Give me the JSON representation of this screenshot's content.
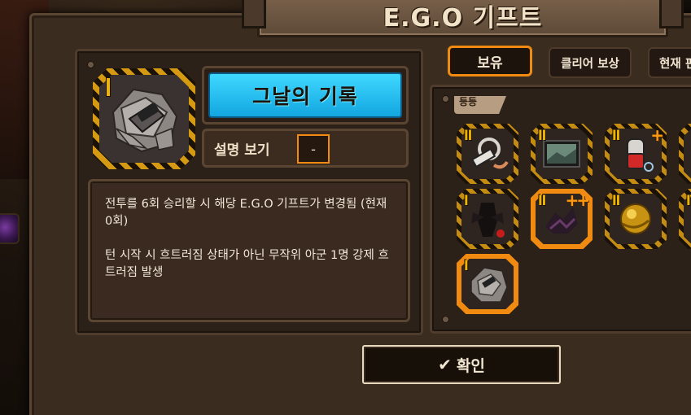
{
  "window": {
    "title": "E.G.O 기프트"
  },
  "gift": {
    "name": "그날의 기록",
    "rank": "I",
    "description_toggle_label": "설명 보기",
    "description_toggle_value": "-",
    "description_lines": [
      "전투를 6회 승리할 시 해당 E.G.O 기프트가 변경됨 (현재 0회)",
      "턴 시작 시 흐트러짐 상태가 아닌 무작위 아군 1명 강제 흐트러짐 발생"
    ]
  },
  "tabs": [
    {
      "label": "보유",
      "active": true
    },
    {
      "label": "클리어 보상",
      "active": false
    },
    {
      "label": "현재 핀",
      "active": false
    }
  ],
  "inventory": {
    "header": "등등",
    "slots": [
      {
        "rank": "II",
        "plus": "",
        "icon": "wrench-gear-icon"
      },
      {
        "rank": "II",
        "plus": "",
        "icon": "photo-frame-icon"
      },
      {
        "rank": "II",
        "plus": "+",
        "icon": "fire-extinguisher-icon"
      },
      {
        "rank": "",
        "plus": "",
        "icon": "partial-icon"
      },
      {
        "rank": "I",
        "plus": "",
        "icon": "shadow-figure-icon"
      },
      {
        "rank": "II",
        "plus": "++",
        "icon": "dark-creature-icon"
      },
      {
        "rank": "II",
        "plus": "",
        "icon": "golden-orb-icon"
      },
      {
        "rank": "IV",
        "plus": "",
        "icon": "partial-icon"
      },
      {
        "rank": "I",
        "plus": "",
        "icon": "paper-record-icon",
        "selected": true
      }
    ]
  },
  "confirm": {
    "label": "확인",
    "icon": "checkmark-icon"
  },
  "colors": {
    "accent_orange": "#f08a10",
    "rank_gold": "#f0b400",
    "name_cyan": "#2fc4f5"
  }
}
